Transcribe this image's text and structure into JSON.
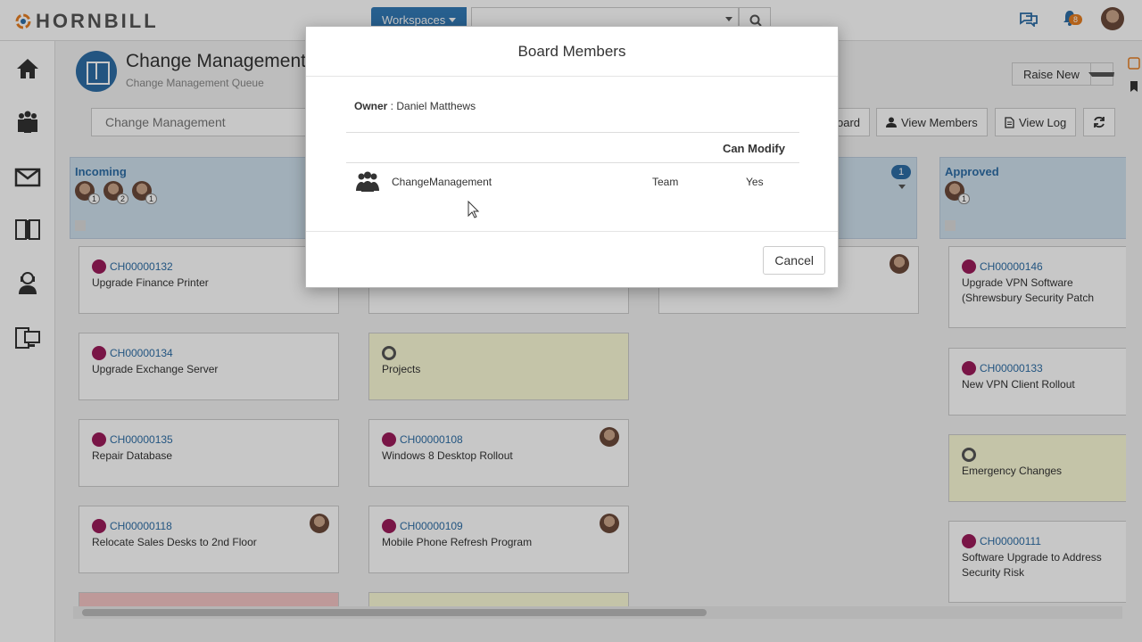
{
  "app": {
    "brand": "HORNBILL"
  },
  "topbar": {
    "workspaces_label": "Workspaces",
    "notification_count": "8"
  },
  "header": {
    "title": "Change Management",
    "subtitle": "Change Management Queue",
    "raise_new": "Raise New"
  },
  "toolbar": {
    "board_select": "Change Management",
    "board_partial": "oard",
    "view_members": "View Members",
    "view_log": "View Log"
  },
  "lanes": [
    {
      "title": "Incoming",
      "avatar_counts": [
        "1",
        "2",
        "1"
      ],
      "cards": [
        {
          "id": "CH00000132",
          "title": "Upgrade Finance Printer"
        },
        {
          "id": "CH00000134",
          "title": "Upgrade Exchange Server"
        },
        {
          "id": "CH00000135",
          "title": "Repair Database"
        },
        {
          "id": "CH00000118",
          "title": "Relocate Sales Desks to 2nd Floor"
        }
      ]
    },
    {
      "cards": [
        {
          "id": "",
          "title": "Projects"
        },
        {
          "id": "CH00000108",
          "title": "Windows 8 Desktop Rollout"
        },
        {
          "id": "CH00000109",
          "title": "Mobile Phone Refresh Program"
        }
      ]
    },
    {
      "count": "1"
    },
    {
      "title": "Approved",
      "avatar_counts": [
        "1"
      ],
      "cards": [
        {
          "id": "CH00000146",
          "title": "Upgrade VPN Software (Shrewsbury Security Patch"
        },
        {
          "id": "CH00000133",
          "title": "New VPN Client Rollout"
        },
        {
          "id": "",
          "title": "Emergency Changes"
        },
        {
          "id": "CH00000111",
          "title": "Software Upgrade to Address Security Risk"
        }
      ]
    }
  ],
  "modal": {
    "title": "Board Members",
    "owner_label": "Owner",
    "owner_name": "Daniel Matthews",
    "column_can_modify": "Can Modify",
    "members": [
      {
        "name": "ChangeManagement",
        "type": "Team",
        "can_modify": "Yes"
      }
    ],
    "cancel_label": "Cancel"
  },
  "colors": {
    "brand_blue": "#2e6ea6",
    "lane_header": "#cfe0ee",
    "change_icon": "#9b1b5a",
    "badge_orange": "#e67e22"
  }
}
